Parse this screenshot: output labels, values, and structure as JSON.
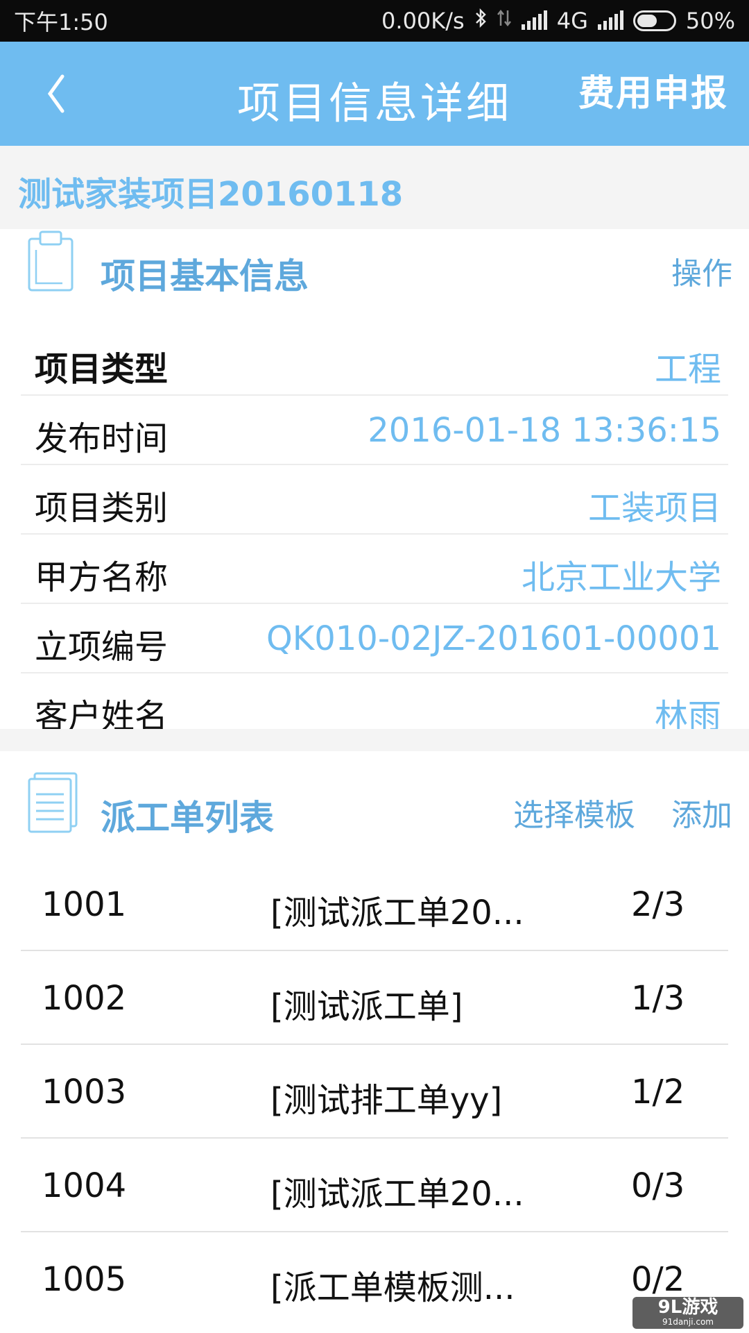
{
  "status_bar": {
    "time": "下午1:50",
    "network_speed": "0.00K/s",
    "network_type": "4G",
    "battery": "50%",
    "icons": [
      "bluetooth-icon",
      "data-transfer-icon",
      "signal-icon",
      "signal-icon",
      "battery-icon"
    ]
  },
  "header": {
    "back_icon": "chevron-left-icon",
    "title": "项目信息详细",
    "fee_report_label": "费用申报"
  },
  "project": {
    "name": "测试家装项目20160118"
  },
  "basic_info": {
    "icon": "clipboard-icon",
    "title": "项目基本信息",
    "action_label": "操作",
    "rows": [
      {
        "label": "项目类型",
        "value": "工程"
      },
      {
        "label": "发布时间",
        "value": "2016-01-18 13:36:15"
      },
      {
        "label": "项目类别",
        "value": "工装项目"
      },
      {
        "label": "甲方名称",
        "value": "北京工业大学"
      },
      {
        "label": "立项编号",
        "value": "QK010-02JZ-201601-00001"
      },
      {
        "label": "客户姓名",
        "value": "林雨"
      }
    ]
  },
  "work_orders": {
    "icon": "document-list-icon",
    "title": "派工单列表",
    "select_template_label": "选择模板",
    "add_label": "添加",
    "rows": [
      {
        "id": "1001",
        "name": "[测试派工单20...",
        "progress": "2/3"
      },
      {
        "id": "1002",
        "name": "[测试派工单]",
        "progress": "1/3"
      },
      {
        "id": "1003",
        "name": "[测试排工单yy]",
        "progress": "1/2"
      },
      {
        "id": "1004",
        "name": "[测试派工单20...",
        "progress": "0/3"
      },
      {
        "id": "1005",
        "name": "[派工单模板测...",
        "progress": "0/2"
      }
    ]
  },
  "watermark": {
    "text": "9L游戏",
    "subtext": "91danji.com"
  },
  "colors": {
    "accent": "#6fbcf0",
    "section_title": "#5ea8dc",
    "status_bar_bg": "#0b0b0b"
  }
}
